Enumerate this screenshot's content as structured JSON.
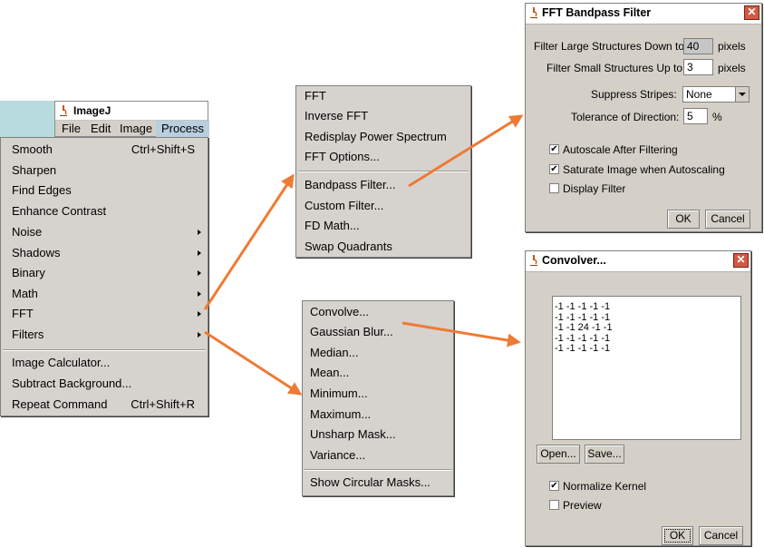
{
  "imagej": {
    "title": "ImageJ",
    "menubar": [
      "File",
      "Edit",
      "Image",
      "Process"
    ],
    "active_menu": "Process"
  },
  "process_menu": {
    "items": [
      {
        "label": "Smooth",
        "accel": "Ctrl+Shift+S"
      },
      {
        "label": "Sharpen"
      },
      {
        "label": "Find Edges"
      },
      {
        "label": "Enhance Contrast"
      },
      {
        "label": "Noise",
        "submenu": true
      },
      {
        "label": "Shadows",
        "submenu": true
      },
      {
        "label": "Binary",
        "submenu": true
      },
      {
        "label": "Math",
        "submenu": true
      },
      {
        "label": "FFT",
        "submenu": true
      },
      {
        "label": "Filters",
        "submenu": true
      },
      {
        "label": "Image Calculator..."
      },
      {
        "label": "Subtract Background..."
      },
      {
        "label": "Repeat Command",
        "accel": "Ctrl+Shift+R"
      }
    ]
  },
  "fft_menu": {
    "items": [
      "FFT",
      "Inverse FFT",
      "Redisplay Power Spectrum",
      "FFT Options...",
      "Bandpass Filter...",
      "Custom Filter...",
      "FD Math...",
      "Swap Quadrants"
    ]
  },
  "filters_menu": {
    "items": [
      "Convolve...",
      "Gaussian Blur...",
      "Median...",
      "Mean...",
      "Minimum...",
      "Maximum...",
      "Unsharp Mask...",
      "Variance...",
      "Show Circular Masks..."
    ]
  },
  "bandpass_dialog": {
    "title": "FFT Bandpass Filter",
    "large_label": "Filter Large Structures Down to",
    "large_value": "40",
    "large_unit": "pixels",
    "small_label": "Filter Small Structures Up to",
    "small_value": "3",
    "small_unit": "pixels",
    "stripes_label": "Suppress Stripes:",
    "stripes_value": "None",
    "tolerance_label": "Tolerance of Direction:",
    "tolerance_value": "5",
    "tolerance_unit": "%",
    "autoscale_label": "Autoscale After Filtering",
    "autoscale_checked": true,
    "saturate_label": "Saturate Image when Autoscaling",
    "saturate_checked": true,
    "display_label": "Display Filter",
    "display_checked": false,
    "ok_label": "OK",
    "cancel_label": "Cancel"
  },
  "convolver_dialog": {
    "title": "Convolver...",
    "kernel_text": "-1 -1 -1 -1 -1\n-1 -1 -1 -1 -1\n-1 -1 24 -1 -1\n-1 -1 -1 -1 -1\n-1 -1 -1 -1 -1",
    "open_label": "Open...",
    "save_label": "Save...",
    "normalize_label": "Normalize Kernel",
    "normalize_checked": true,
    "preview_label": "Preview",
    "preview_checked": false,
    "ok_label": "OK",
    "cancel_label": "Cancel"
  },
  "colors": {
    "arrow": "#ee7a35",
    "menu_bg": "#d6d3ce",
    "highlight": "#b8cfe0",
    "close": "#d25a44"
  },
  "icons": [
    "imagej-microscope-icon",
    "submenu-arrow-icon",
    "close-icon",
    "dropdown-arrow-icon",
    "checkmark-icon"
  ]
}
